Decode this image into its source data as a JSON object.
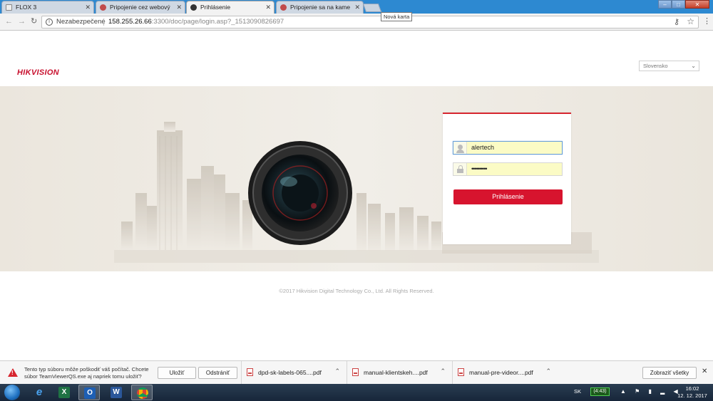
{
  "browser": {
    "tabs": [
      {
        "title": "FLOX 3",
        "favicon_color": "#f0f0f0"
      },
      {
        "title": "Pripojenie cez webový prehliadač",
        "favicon_color": "#c14b4b"
      },
      {
        "title": "Prihlásenie",
        "favicon_color": "#333333"
      },
      {
        "title": "Pripojenie sa na kameru",
        "favicon_color": "#c14b4b"
      }
    ],
    "tooltip": "Nová karta",
    "window_buttons": {
      "minimize": "–",
      "maximize": "□",
      "close": "✕"
    },
    "security_label": "Nezabezpečené",
    "url_host": "158.255.26.66",
    "url_rest": ":3300/doc/page/login.asp?_1513090826697"
  },
  "page": {
    "logo": "HIKVISION",
    "language": "Slovensko",
    "login": {
      "username_value": "alertech",
      "password_value": "••••••••••",
      "button_label": "Prihlásenie"
    },
    "copyright": "©2017 Hikvision Digital Technology Co., Ltd. All Rights Reserved."
  },
  "download_bar": {
    "warning_text": "Tento typ súboru môže poškodiť váš počítač. Chcete súbor TeamViewerQS.exe aj napriek tomu uložiť?",
    "save_label": "Uložiť",
    "discard_label": "Odstrániť",
    "downloads": [
      {
        "name": "dpd-sk-labels-065....pdf"
      },
      {
        "name": "manual-klientskeh....pdf"
      },
      {
        "name": "manual-pre-videor....pdf"
      }
    ],
    "show_all_label": "Zobraziť všetky"
  },
  "taskbar": {
    "apps": [
      "windows-explorer",
      "internet-explorer",
      "excel",
      "outlook",
      "word",
      "chrome"
    ],
    "language": "SK",
    "battery_time": "(4:43)",
    "time": "16:02",
    "date": "12. 12. 2017"
  },
  "colors": {
    "accent_red": "#d7142e",
    "taskbar": "#1c2d42",
    "input_fill": "#fbfbc5"
  }
}
